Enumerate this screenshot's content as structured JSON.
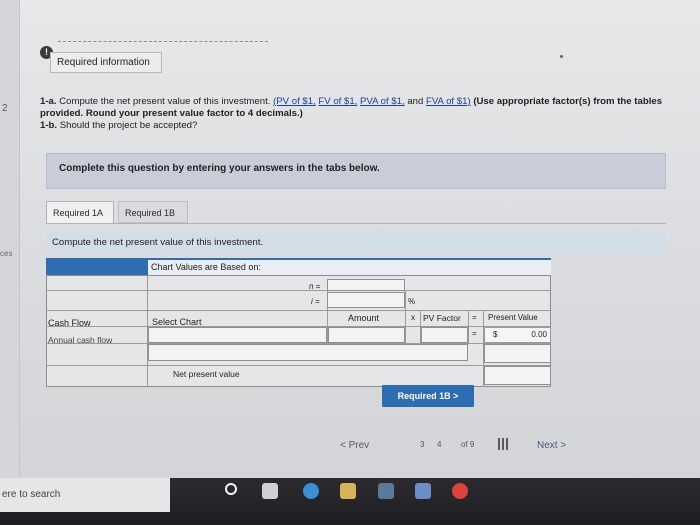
{
  "sidebar": {
    "number": "2",
    "label": "ces"
  },
  "header": {
    "badge": "!",
    "required_info": "Required information"
  },
  "problem": {
    "part_a_label": "1-a.",
    "part_a_text": "Compute the net present value of this investment.",
    "links": [
      "(PV of $1,",
      "FV of $1,",
      "PVA of $1,",
      "and",
      "FVA of $1)"
    ],
    "instructions": "(Use appropriate factor(s) from the tables provided. Round your present value factor to 4 decimals.)",
    "part_b_label": "1-b.",
    "part_b_text": "Should the project be accepted?"
  },
  "banner": {
    "text": "Complete this question by entering your answers in the tabs below."
  },
  "tabs": [
    {
      "label": "Required 1A",
      "active": true
    },
    {
      "label": "Required 1B",
      "active": false
    }
  ],
  "question": {
    "text": "Compute the net present value of this investment."
  },
  "table": {
    "chart_values_label": "Chart Values are Based on:",
    "n_label": "n =",
    "i_label": "i =",
    "percent": "%",
    "headers": {
      "cash_flow": "Cash Flow",
      "select_chart": "Select Chart",
      "amount": "Amount",
      "times": "x",
      "pv_factor": "PV Factor",
      "equals": "=",
      "present_value": "Present Value"
    },
    "row_annual": {
      "label": "Annual cash flow",
      "equals": "=",
      "currency": "$",
      "present_value": "0.00"
    },
    "net_pv_label": "Net present value"
  },
  "buttons": {
    "next_tab": "Required 1B  >",
    "prev": "<  Prev",
    "next": "Next  >"
  },
  "pagination": {
    "current": "3",
    "next_page": "4",
    "of_label": "of 9"
  },
  "taskbar": {
    "search": "ere to search"
  },
  "colors": {
    "accent": "#2f6db3",
    "banner": "#c9ccd9",
    "question_bar": "#d3dde7"
  }
}
